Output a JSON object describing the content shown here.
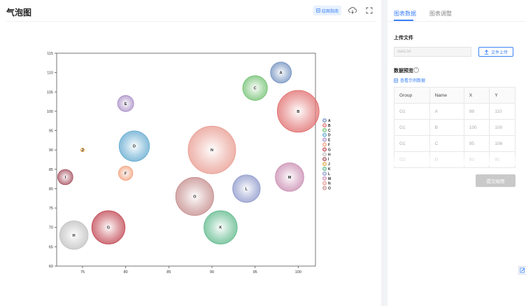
{
  "header": {
    "title": "气泡图",
    "guide_label": "绘图指南",
    "download_icon": "cloud-download-icon",
    "fullscreen_icon": "fullscreen-icon"
  },
  "chart_data": {
    "type": "scatter",
    "xlim": [
      72,
      102
    ],
    "ylim": [
      60,
      115
    ],
    "x_ticks": [
      75,
      80,
      85,
      90,
      95,
      100
    ],
    "y_ticks": [
      60,
      65,
      70,
      75,
      80,
      85,
      90,
      95,
      100,
      105,
      110,
      115
    ],
    "legend_position": "right",
    "series": [
      {
        "name": "A",
        "x": 98,
        "y": 110,
        "size": 2.2,
        "color": "#6f8fbf"
      },
      {
        "name": "B",
        "x": 100,
        "y": 100,
        "size": 4.4,
        "color": "#e06b6b"
      },
      {
        "name": "C",
        "x": 95,
        "y": 106,
        "size": 2.6,
        "color": "#6fbf6f"
      },
      {
        "name": "D",
        "x": 81,
        "y": 91,
        "size": 3.2,
        "color": "#5fa8cf"
      },
      {
        "name": "E",
        "x": 80,
        "y": 102,
        "size": 1.7,
        "color": "#a98cc6"
      },
      {
        "name": "F",
        "x": 80,
        "y": 84,
        "size": 1.5,
        "color": "#f2a07a"
      },
      {
        "name": "G",
        "x": 78,
        "y": 70,
        "size": 3.5,
        "color": "#c0434f"
      },
      {
        "name": "H",
        "x": 74,
        "y": 68,
        "size": 3.0,
        "color": "#bfbfbf"
      },
      {
        "name": "I",
        "x": 73,
        "y": 83,
        "size": 1.6,
        "color": "#a44a5a"
      },
      {
        "name": "J",
        "x": 75,
        "y": 90,
        "size": 0.4,
        "color": "#e6a84a"
      },
      {
        "name": "K",
        "x": 91,
        "y": 70,
        "size": 3.5,
        "color": "#5cb88a"
      },
      {
        "name": "L",
        "x": 94,
        "y": 80,
        "size": 2.9,
        "color": "#8a95c9"
      },
      {
        "name": "M",
        "x": 99,
        "y": 83,
        "size": 3.0,
        "color": "#c98ab0"
      },
      {
        "name": "N",
        "x": 90,
        "y": 90,
        "size": 5.0,
        "color": "#e89a8f"
      },
      {
        "name": "O",
        "x": 88,
        "y": 78,
        "size": 4.0,
        "color": "#c48a8a"
      }
    ]
  },
  "panel": {
    "tabs": [
      {
        "label": "图表数据"
      },
      {
        "label": "图表调整"
      }
    ],
    "upload_section_label": "上传文件",
    "file_input_placeholder": "data.txt",
    "upload_button_label": "文件上传",
    "preview_label": "数据预览",
    "sample_link_label": "查看示例数据",
    "table": {
      "headers": [
        "Group",
        "Name",
        "X",
        "Y"
      ],
      "rows": [
        [
          "G1",
          "A",
          "98",
          "110"
        ],
        [
          "G1",
          "B",
          "100",
          "100"
        ],
        [
          "G1",
          "C",
          "95",
          "106"
        ],
        [
          "G2",
          "D",
          "81",
          "91"
        ]
      ]
    },
    "submit_label": "提交绘图"
  }
}
